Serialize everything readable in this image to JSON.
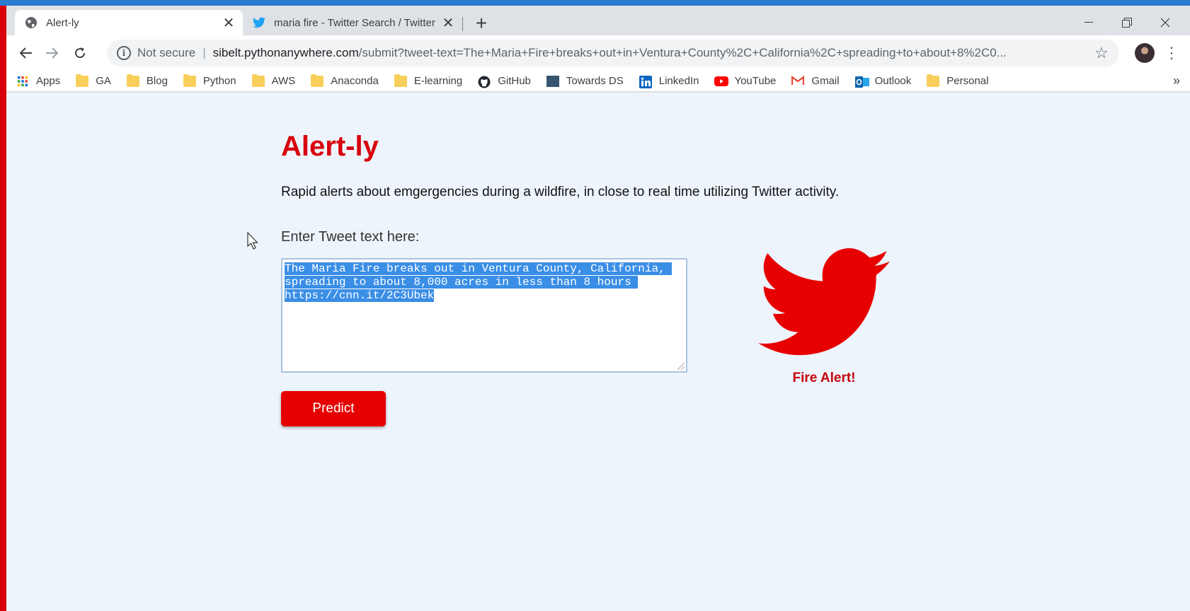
{
  "browser": {
    "tabs": [
      {
        "title": "Alert-ly",
        "active": true
      },
      {
        "title": "maria fire - Twitter Search / Twitter",
        "active": false
      }
    ],
    "new_tab": "+",
    "address": {
      "security": "Not secure",
      "host": "sibelt.pythonanywhere.com",
      "path": "/submit?tweet-text=The+Maria+Fire+breaks+out+in+Ventura+County%2C+California%2C+spreading+to+about+8%2C0..."
    },
    "bookmarks": [
      {
        "label": "Apps",
        "icon": "apps-grid-icon"
      },
      {
        "label": "GA",
        "icon": "folder-icon"
      },
      {
        "label": "Blog",
        "icon": "folder-icon"
      },
      {
        "label": "Python",
        "icon": "folder-icon"
      },
      {
        "label": "AWS",
        "icon": "folder-icon"
      },
      {
        "label": "Anaconda",
        "icon": "folder-icon"
      },
      {
        "label": "E-learning",
        "icon": "folder-icon"
      },
      {
        "label": "GitHub",
        "icon": "github-icon"
      },
      {
        "label": "Towards DS",
        "icon": "towards-ds-icon"
      },
      {
        "label": "LinkedIn",
        "icon": "linkedin-icon"
      },
      {
        "label": "YouTube",
        "icon": "youtube-icon"
      },
      {
        "label": "Gmail",
        "icon": "gmail-icon"
      },
      {
        "label": "Outlook",
        "icon": "outlook-icon"
      },
      {
        "label": "Personal",
        "icon": "folder-icon"
      }
    ],
    "bookmarks_more": "»"
  },
  "app": {
    "title": "Alert-ly",
    "tagline": "Rapid alerts about emgergencies during a wildfire, in close to real time utilizing Twitter activity.",
    "input_label": "Enter Tweet text here:",
    "tweet_text": "The Maria Fire breaks out in Ventura County, California, spreading to about 8,000 acres in less than 8 hours https://cnn.it/2C3Ubek",
    "predict_label": "Predict",
    "result_label": "Fire Alert!"
  },
  "colors": {
    "brand_red": "#d8000c",
    "button_red": "#e60000",
    "page_bg": "#edf4fb",
    "selection": "#3a8ee6"
  }
}
